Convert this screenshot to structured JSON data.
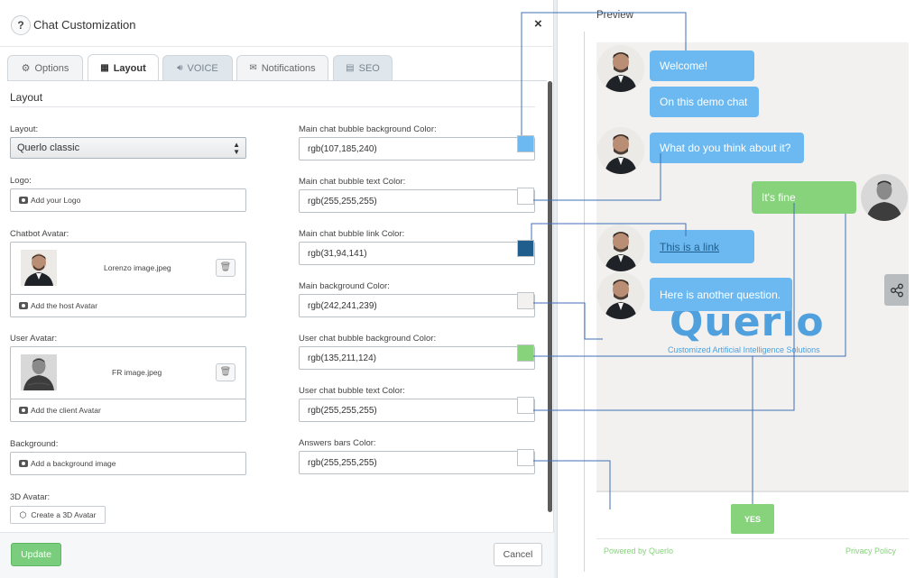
{
  "header": {
    "help_label": "?",
    "title": "Chat Customization",
    "close_label": "×"
  },
  "tabs": [
    {
      "label": "Options",
      "icon": "gears-icon",
      "state": "normal"
    },
    {
      "label": "Layout",
      "icon": "layout-icon",
      "state": "active"
    },
    {
      "label": "VOICE",
      "icon": "speaker-icon",
      "state": "disabled"
    },
    {
      "label": "Notifications",
      "icon": "envelope-icon",
      "state": "normal"
    },
    {
      "label": "SEO",
      "icon": "document-icon",
      "state": "disabled"
    }
  ],
  "section_title": "Layout",
  "form": {
    "layout_label": "Layout:",
    "layout_value": "Querlo classic",
    "logo_label": "Logo:",
    "logo_button": "Add your Logo",
    "chatbot_avatar_label": "Chatbot Avatar:",
    "chatbot_avatar_file": "Lorenzo image.jpeg",
    "chatbot_avatar_button": "Add the host Avatar",
    "user_avatar_label": "User Avatar:",
    "user_avatar_file": "FR image.jpeg",
    "user_avatar_button": "Add the client Avatar",
    "background_label": "Background:",
    "background_button": "Add a background image",
    "avatar3d_label": "3D Avatar:",
    "avatar3d_button": "Create a 3D Avatar"
  },
  "colors": [
    {
      "label": "Main chat bubble background Color:",
      "value": "rgb(107,185,240)",
      "swatch": "#6bb9f0"
    },
    {
      "label": "Main chat bubble text Color:",
      "value": "rgb(255,255,255)",
      "swatch": "#ffffff"
    },
    {
      "label": "Main chat bubble link Color:",
      "value": "rgb(31,94,141)",
      "swatch": "#1f5e8d"
    },
    {
      "label": "Main background Color:",
      "value": "rgb(242,241,239)",
      "swatch": "#f2f1ef"
    },
    {
      "label": "User chat bubble background Color:",
      "value": "rgb(135,211,124)",
      "swatch": "#87d37c"
    },
    {
      "label": "User chat bubble text Color:",
      "value": "rgb(255,255,255)",
      "swatch": "#ffffff"
    },
    {
      "label": "Answers bars Color:",
      "value": "rgb(255,255,255)",
      "swatch": "#ffffff"
    }
  ],
  "footer": {
    "update": "Update",
    "cancel": "Cancel"
  },
  "preview": {
    "title": "Preview",
    "messages": [
      {
        "text": "Welcome!",
        "from": "bot"
      },
      {
        "text": "On this demo chat",
        "from": "bot"
      },
      {
        "text": "What do you think about it?",
        "from": "bot"
      },
      {
        "text": "It's fine",
        "from": "user"
      },
      {
        "text": "This is a link",
        "from": "bot",
        "link": true
      },
      {
        "text": "Here is another question.",
        "from": "bot"
      }
    ],
    "brand": "Querlo",
    "brand_tagline": "Customized Artificial Intelligence Solutions",
    "answer_button": "YES",
    "powered_by": "Powered by Querlo",
    "privacy": "Privacy Policy"
  }
}
